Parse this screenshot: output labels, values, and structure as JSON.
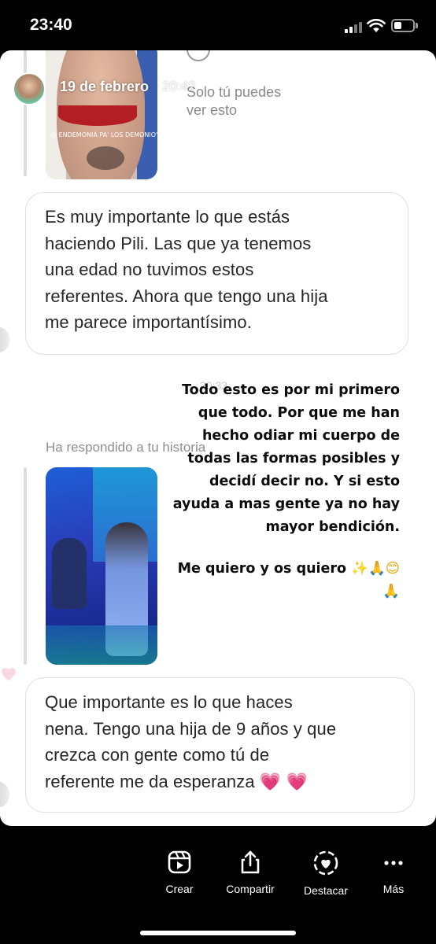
{
  "status_bar": {
    "time": "23:40"
  },
  "story": {
    "header": {
      "date": "19 de febrero",
      "time": "20:42"
    },
    "private_notice": {
      "line1": "Solo tú puedes",
      "line2": "ver esto"
    },
    "top_thumbnail_caption": "@ ENDEMONIÁ PA' LOS DEMONIO'",
    "reply_label": "Ha respondido a tu historia",
    "faint_time": "20:33",
    "message_1_lines": [
      "Es muy importante lo que estás",
      "haciendo Pili. Las que ya tenemos",
      "una edad no tuvimos estos",
      "referentes. Ahora que tengo una hija",
      "me parece importantísimo."
    ],
    "message_2_lines": [
      "Que importante es lo que haces",
      "nena. Tengo una hija de 9 años y que",
      "crezca con gente como tú de",
      "referente me da esperanza 💗 💗"
    ],
    "overlay_lines": [
      "Todo esto es por mi primero",
      "que todo. Por que me han",
      "hecho odiar mi cuerpo de",
      "todas las formas posibles y",
      "decidí decir no. Y si esto",
      "ayuda a mas gente ya no hay",
      "mayor bendición."
    ],
    "overlay_closing": "Me quiero y os quiero",
    "overlay_closing_emojis": "✨🙏😊",
    "overlay_final_emoji": "🙏"
  },
  "toolbar": {
    "items": [
      {
        "label": "Crear",
        "icon": "reel-icon"
      },
      {
        "label": "Compartir",
        "icon": "share-icon"
      },
      {
        "label": "Destacar",
        "icon": "highlight-heart-icon"
      },
      {
        "label": "Más",
        "icon": "more-icon"
      }
    ]
  },
  "colors": {
    "bubble_border": "#dfdfdf",
    "secondary_text": "#8e8e8e",
    "heart_pink": "#f7c6d3"
  }
}
